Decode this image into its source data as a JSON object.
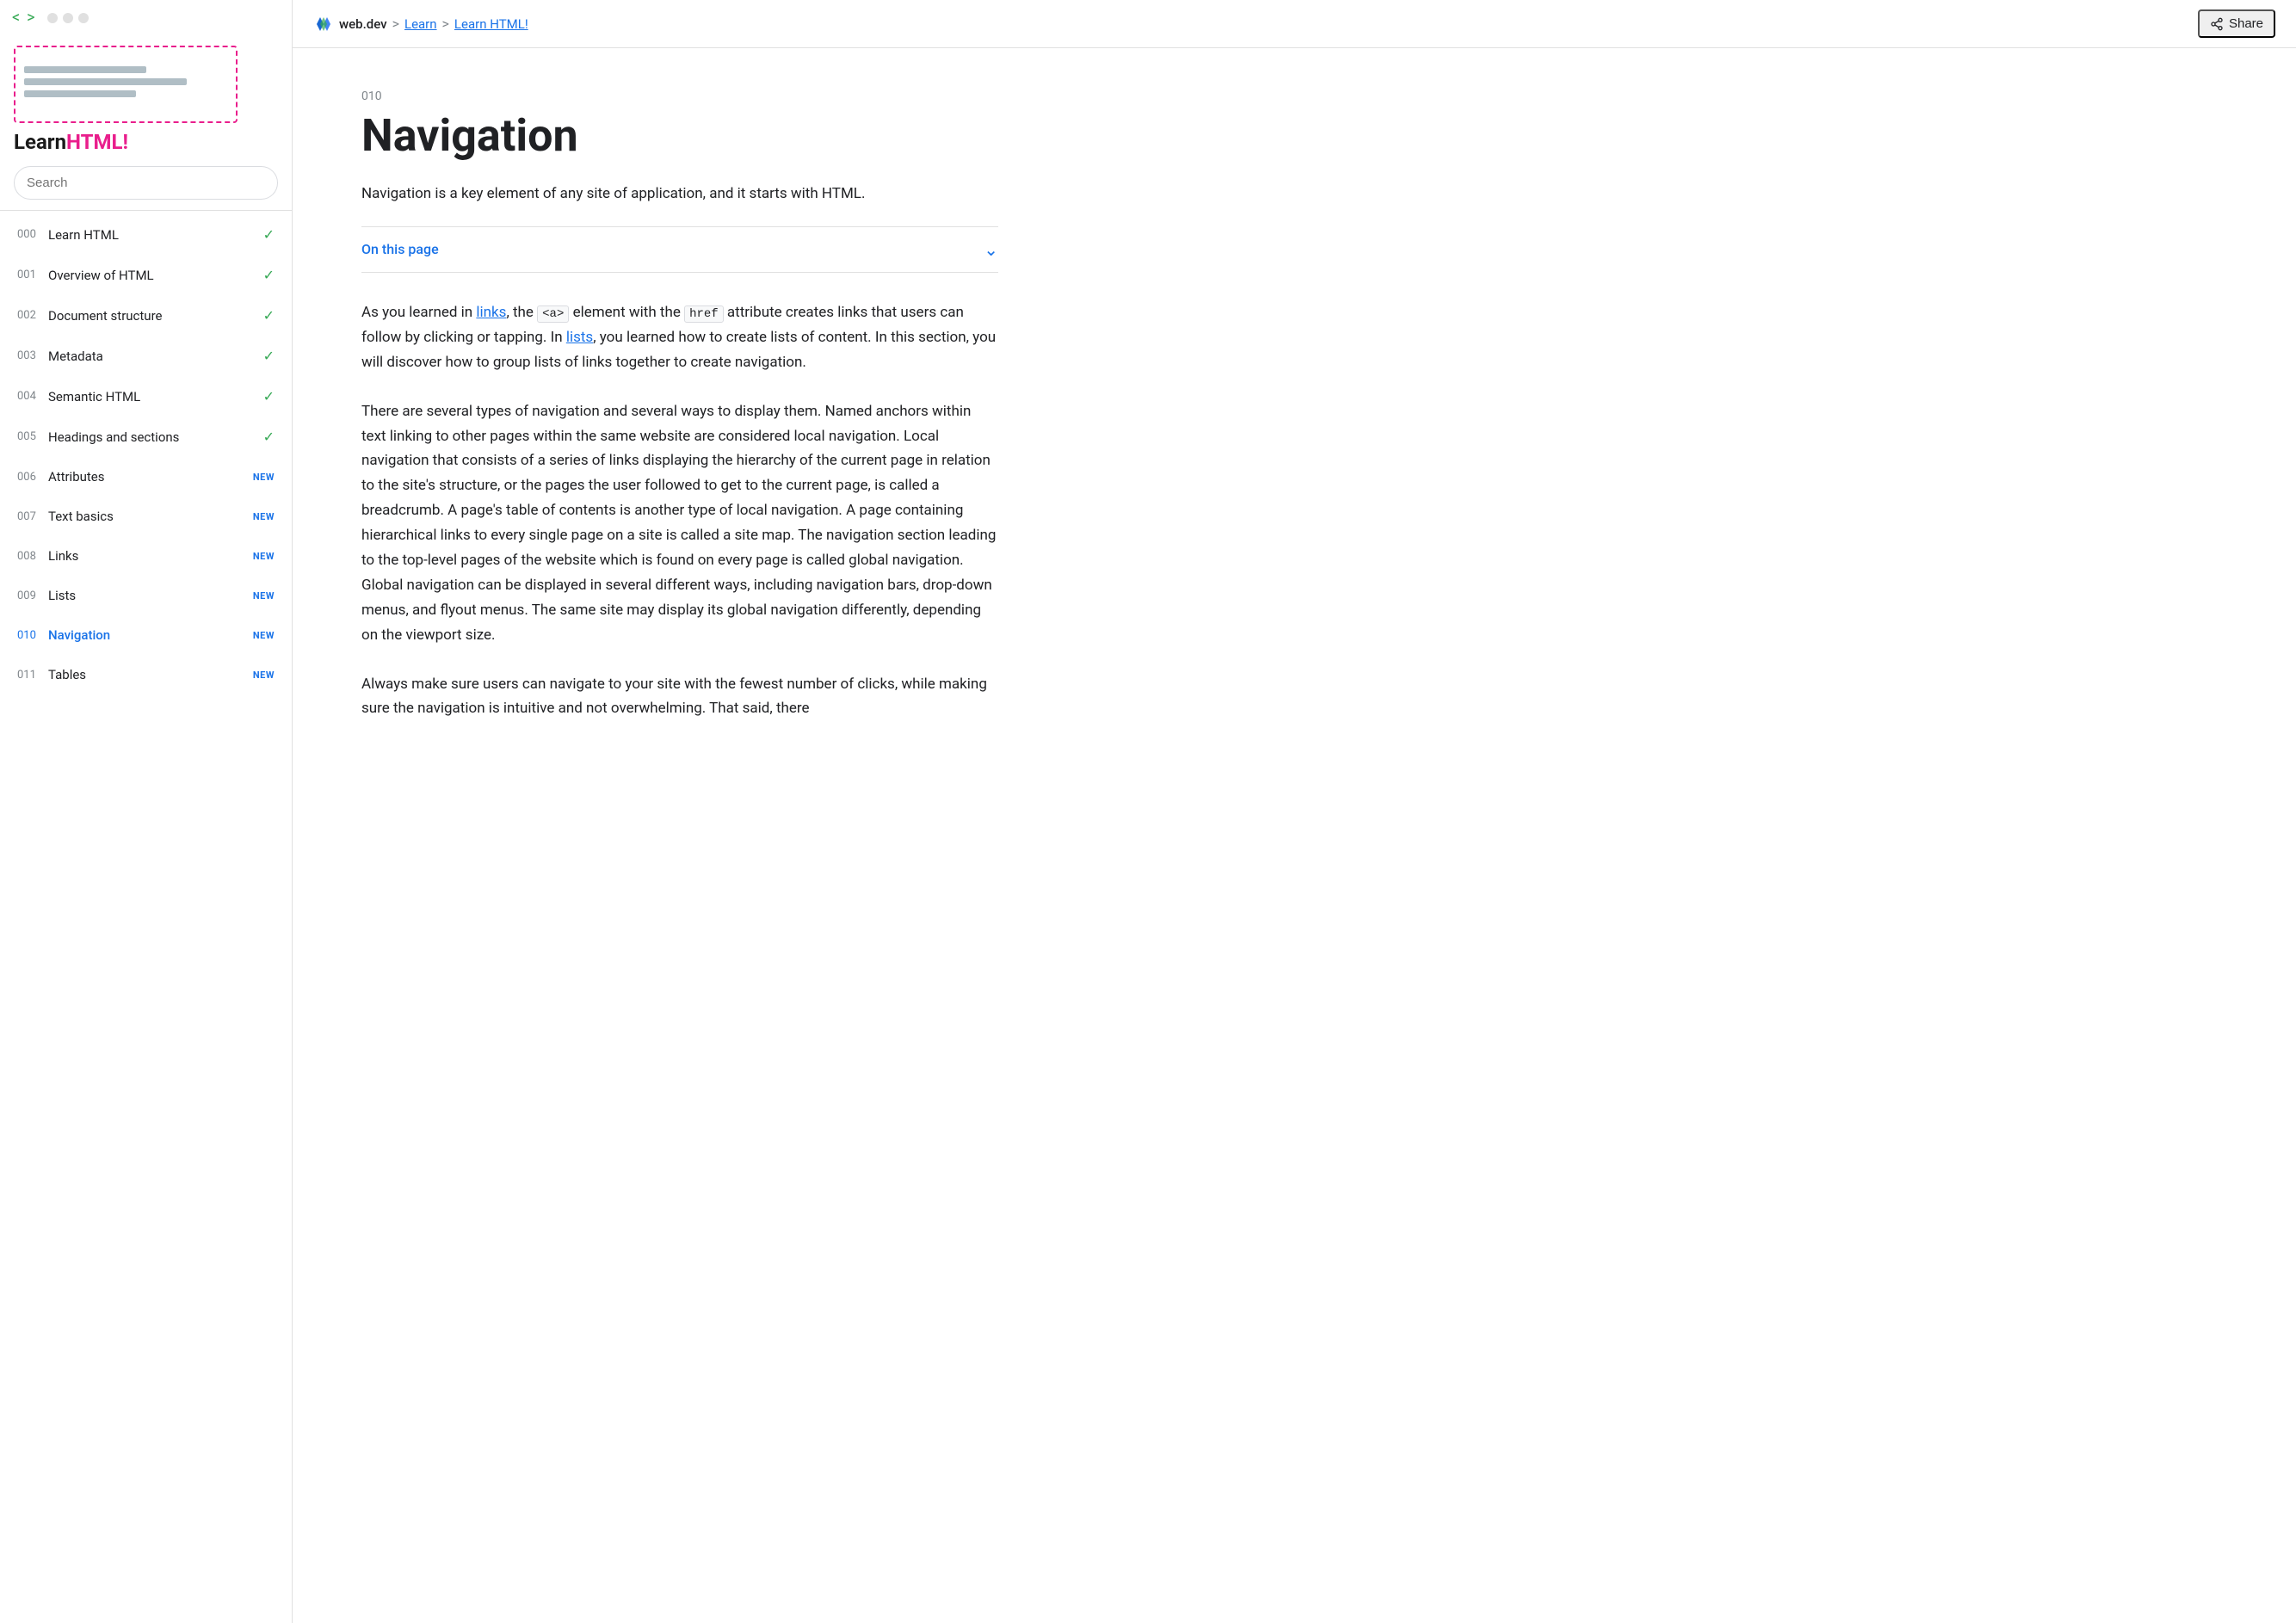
{
  "window": {
    "chrome_buttons": [
      "close",
      "minimize",
      "maximize"
    ]
  },
  "sidebar": {
    "title_plain": "Learn",
    "title_colored": "HTML!",
    "search_placeholder": "Search",
    "nav_items": [
      {
        "number": "000",
        "label": "Learn HTML",
        "badge": "check",
        "active": false
      },
      {
        "number": "001",
        "label": "Overview of HTML",
        "badge": "check",
        "active": false
      },
      {
        "number": "002",
        "label": "Document structure",
        "badge": "check",
        "active": false
      },
      {
        "number": "003",
        "label": "Metadata",
        "badge": "check",
        "active": false
      },
      {
        "number": "004",
        "label": "Semantic HTML",
        "badge": "check",
        "active": false
      },
      {
        "number": "005",
        "label": "Headings and sections",
        "badge": "check",
        "active": false
      },
      {
        "number": "006",
        "label": "Attributes",
        "badge": "NEW",
        "active": false
      },
      {
        "number": "007",
        "label": "Text basics",
        "badge": "NEW",
        "active": false
      },
      {
        "number": "008",
        "label": "Links",
        "badge": "NEW",
        "active": false
      },
      {
        "number": "009",
        "label": "Lists",
        "badge": "NEW",
        "active": false
      },
      {
        "number": "010",
        "label": "Navigation",
        "badge": "NEW",
        "active": true
      },
      {
        "number": "011",
        "label": "Tables",
        "badge": "NEW",
        "active": false
      }
    ]
  },
  "topbar": {
    "site_name": "web.dev",
    "breadcrumb_sep1": ">",
    "breadcrumb_learn": "Learn",
    "breadcrumb_sep2": ">",
    "breadcrumb_current": "Learn HTML!",
    "share_label": "Share"
  },
  "main": {
    "section_number": "010",
    "page_title": "Navigation",
    "subtitle": "Navigation is a key element of any site of application, and it starts with HTML.",
    "on_this_page": "On this page",
    "para1_prefix": "As you learned in ",
    "para1_link1": "links",
    "para1_mid1": ", the ",
    "para1_code1": "<a>",
    "para1_mid2": " element with the ",
    "para1_code2": "href",
    "para1_mid3": " attribute creates links that users can follow by clicking or tapping. In ",
    "para1_link2": "lists",
    "para1_mid4": ", you learned how to create lists of content. In this section, you will discover how to group lists of links together to create navigation.",
    "para2": "There are several types of navigation and several ways to display them. Named anchors within text linking to other pages within the same website are considered local navigation. Local navigation that consists of a series of links displaying the hierarchy of the current page in relation to the site's structure, or the pages the user followed to get to the current page, is called a breadcrumb. A page's table of contents is another type of local navigation. A page containing hierarchical links to every single page on a site is called a site map. The navigation section leading to the top-level pages of the website which is found on every page is called global navigation. Global navigation can be displayed in several different ways, including navigation bars, drop-down menus, and flyout menus. The same site may display its global navigation differently, depending on the viewport size.",
    "para3_start": "Always make sure users can navigate to your site with the fewest number of clicks, while making sure the navigation is intuitive and not overwhelming. That said, there"
  }
}
